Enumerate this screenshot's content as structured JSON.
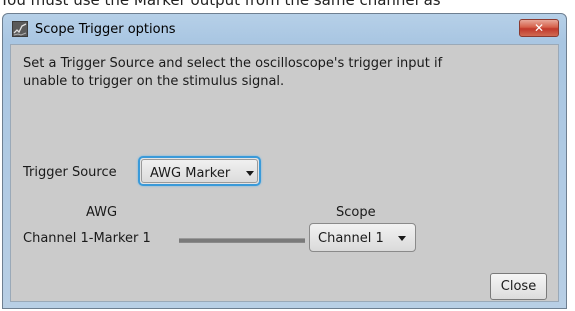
{
  "background": {
    "partial_text": "You must use the Marker output from the same channel as"
  },
  "window": {
    "title": "Scope Trigger options",
    "app_icon": "scope-app-icon",
    "close_glyph": "✕"
  },
  "dialog": {
    "description": "Set a Trigger Source and select the oscilloscope's trigger input if unable to trigger on the stimulus signal.",
    "trigger_source": {
      "label": "Trigger Source",
      "selected": "AWG Marker"
    },
    "mapping": {
      "awg_header": "AWG",
      "scope_header": "Scope",
      "awg_channel": "Channel 1-Marker 1",
      "scope_selected": "Channel 1"
    },
    "close_label": "Close"
  },
  "colors": {
    "focus_accent": "#3a9ad9",
    "close_x_red": "#c1392b",
    "client_bg": "#cbcbcb"
  }
}
